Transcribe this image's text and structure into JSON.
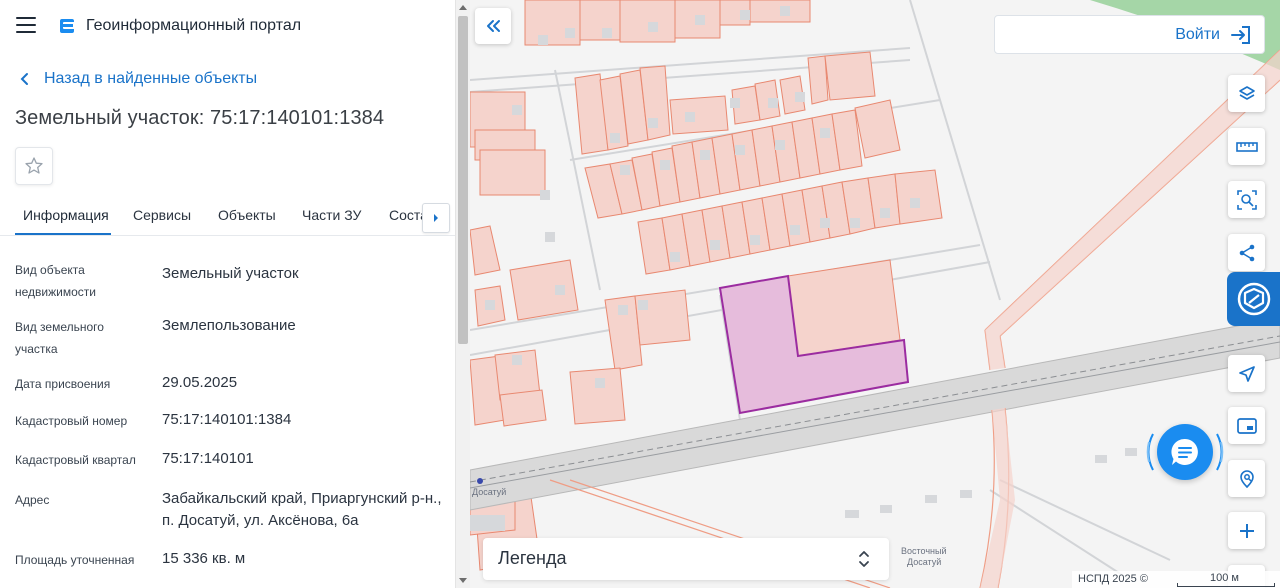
{
  "header": {
    "title": "Геоинформационный портал"
  },
  "nav": {
    "back_label": "Назад в найденные объекты"
  },
  "object": {
    "title": "Земельный участок: 75:17:140101:1384"
  },
  "tabs": [
    {
      "label": "Информация"
    },
    {
      "label": "Сервисы"
    },
    {
      "label": "Объекты"
    },
    {
      "label": "Части ЗУ"
    },
    {
      "label": "Состав"
    }
  ],
  "properties": [
    {
      "label": "Вид объекта недвижимости",
      "value": "Земельный участок"
    },
    {
      "label": "Вид земельного участка",
      "value": "Землепользование"
    },
    {
      "label": "Дата присвоения",
      "value": "29.05.2025"
    },
    {
      "label": "Кадастровый номер",
      "value": "75:17:140101:1384"
    },
    {
      "label": "Кадастровый квартал",
      "value": "75:17:140101"
    },
    {
      "label": "Адрес",
      "value": "Забайкальский край, Приаргунский р-н., п. Досатуй, ул. Аксёнова, 6а"
    },
    {
      "label": "Площадь уточненная",
      "value": "15 336 кв. м"
    }
  ],
  "map": {
    "login_label": "Войти",
    "legend_label": "Легенда",
    "attribution": "НСПД 2025 ©",
    "scale_label": "100 м",
    "place_labels": {
      "station": "Досатуй",
      "east_line1": "Восточный",
      "east_line2": "Досатуй"
    },
    "tools": [
      "layers-icon",
      "ruler-icon",
      "select-area-icon",
      "share-icon",
      "nspd-icon",
      "locate-icon",
      "minimap-icon",
      "search-location-icon",
      "zoom-in-icon"
    ]
  },
  "colors": {
    "accent": "#1a73c9",
    "parcel_fill": "#f5d3cc",
    "parcel_stroke": "#e88870",
    "selected_fill": "#e6bcdc",
    "selected_stroke": "#9b2ca0"
  }
}
